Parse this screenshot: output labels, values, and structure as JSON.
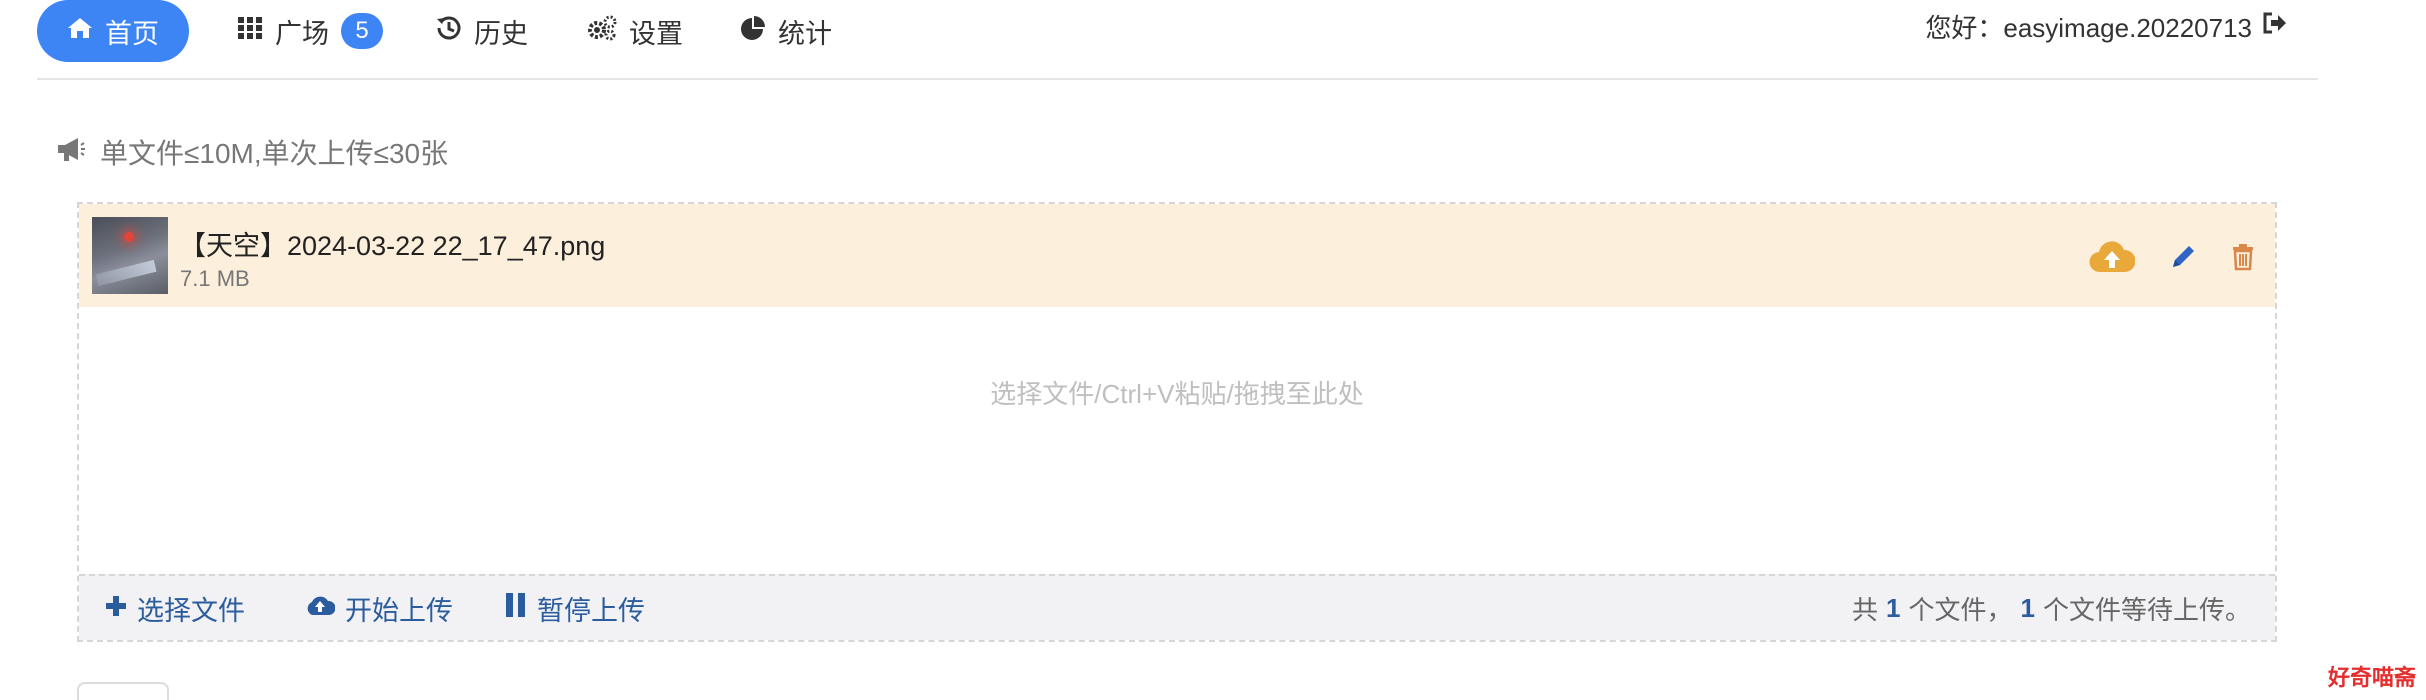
{
  "nav": {
    "home": "首页",
    "plaza": "广场",
    "plaza_badge": "5",
    "history": "历史",
    "settings": "设置",
    "stats": "统计",
    "greeting": "您好：easyimage.20220713"
  },
  "notice": "单文件≤10M,单次上传≤30张",
  "file": {
    "name": "【天空】2024-03-22 22_17_47.png",
    "size": "7.1 MB"
  },
  "drop_hint": "选择文件/Ctrl+V粘贴/拖拽至此处",
  "toolbar": {
    "choose": "选择文件",
    "start": "开始上传",
    "pause": "暂停上传"
  },
  "summary": {
    "prefix": "共",
    "total": "1",
    "mid": "个文件，",
    "waiting": "1",
    "suffix": "个文件等待上传。"
  },
  "watermark": "好奇喵斋",
  "colors": {
    "accent": "#3d84f5",
    "link": "#2b5d9e",
    "file_row_bg": "#fcefdc",
    "upload_icon": "#e9a93a",
    "delete_icon": "#d9884a"
  }
}
